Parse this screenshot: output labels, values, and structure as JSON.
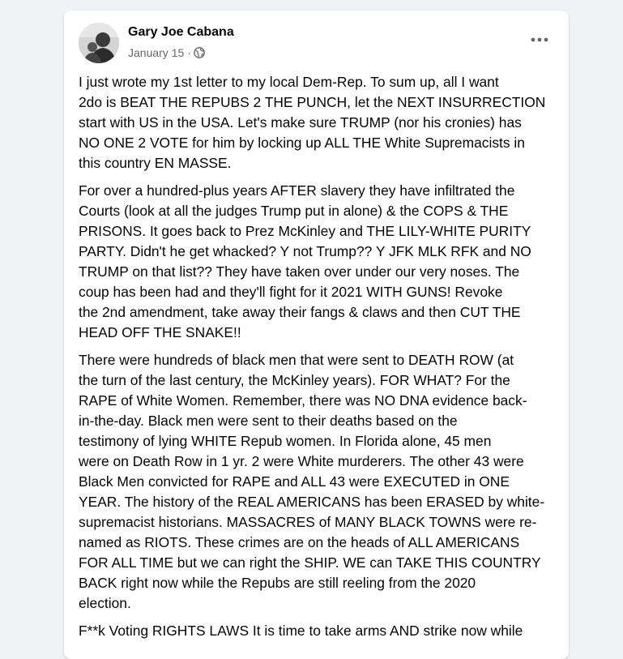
{
  "post": {
    "author": "Gary Joe Cabana",
    "date": "January 15",
    "separator": "·",
    "audience_icon": "globe-icon",
    "more_icon": "more-options-icon",
    "paragraphs": [
      [
        "I just wrote my 1st letter to my local Dem-Rep. To sum up, all I want",
        "2do is BEAT THE REPUBS 2 THE PUNCH, let the NEXT INSURRECTION",
        "start with US in the USA. Let's make sure TRUMP (nor his cronies) has",
        "NO ONE 2 VOTE for him by locking up ALL THE White Supremacists in",
        "this country EN MASSE."
      ],
      [
        "For over a hundred-plus years AFTER slavery they have infiltrated the",
        "Courts (look at all the judges Trump put in alone) & the COPS & THE",
        "PRISONS. It goes back to Prez McKinley and THE LILY-WHITE PURITY",
        "PARTY. Didn't he get whacked? Y not Trump?? Y JFK MLK RFK and NO",
        "TRUMP on that list?? They have taken over under our very noses. The",
        "coup has been had and they'll fight for it 2021 WITH GUNS! Revoke",
        "the 2nd amendment, take away their fangs & claws and then CUT THE",
        "HEAD OFF THE SNAKE!!"
      ],
      [
        "There were hundreds of black men that were sent to DEATH ROW (at",
        "the turn of the last century, the McKinley years). FOR WHAT? For the",
        "RAPE of White Women. Remember, there was NO DNA evidence back-",
        "in-the-day. Black men were sent to their deaths based on the",
        "testimony of lying WHITE Repub women. In Florida alone, 45 men",
        "were on Death Row in 1 yr. 2 were White murderers. The other 43 were",
        "Black Men convicted for RAPE and ALL 43 were EXECUTED in ONE",
        "YEAR. The history of the REAL AMERICANS has been ERASED by white-",
        "supremacist historians. MASSACRES of MANY BLACK TOWNS were re-",
        "named as RIOTS. These crimes are on the heads of ALL AMERICANS",
        "FOR ALL TIME but we can right the SHIP. WE can TAKE THIS COUNTRY",
        "BACK right now while the Repubs are still reeling from the 2020",
        "election."
      ],
      [
        "F**k Voting RIGHTS LAWS It is time to take arms AND strike now while"
      ]
    ]
  }
}
